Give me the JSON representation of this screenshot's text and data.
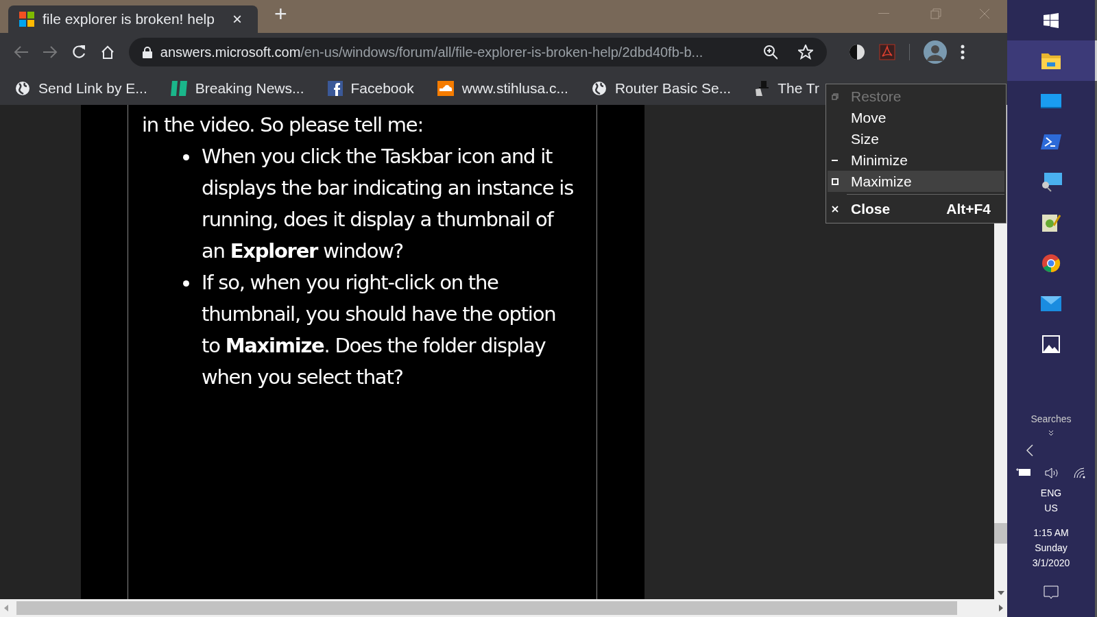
{
  "browser": {
    "tab": {
      "title": "file explorer is broken! help",
      "close": "×"
    },
    "new_tab": "+",
    "address": {
      "host": "answers.microsoft.com",
      "path": "/en-us/windows/forum/all/file-explorer-is-broken-help/2dbd40fb-b..."
    },
    "bookmarks": [
      {
        "kind": "globe",
        "label": "Send Link by E..."
      },
      {
        "kind": "news",
        "label": "Breaking News..."
      },
      {
        "kind": "facebook",
        "label": "Facebook"
      },
      {
        "kind": "cloud",
        "label": "www.stihlusa.c..."
      },
      {
        "kind": "globe",
        "label": "Router Basic Se..."
      },
      {
        "kind": "hat",
        "label": "The Tr"
      }
    ]
  },
  "content": {
    "intro": "in the video. So please tell me:",
    "bullets": [
      "When you click the Taskbar icon and it displays the bar indicating an instance is running, does it display a thumbnail of an **Explorer** window?",
      "If so, when you right-click on the thumbnail, you should have the option to **Maximize**. Does the folder display when you select that?"
    ]
  },
  "window_menu": [
    {
      "kind": "restore",
      "label": "Restore",
      "disabled": true,
      "selected": false
    },
    {
      "kind": "none",
      "label": "Move",
      "disabled": false,
      "selected": false
    },
    {
      "kind": "none",
      "label": "Size",
      "disabled": false,
      "selected": false
    },
    {
      "kind": "minimize",
      "label": "Minimize",
      "disabled": false,
      "selected": false
    },
    {
      "kind": "maximize",
      "label": "Maximize",
      "disabled": false,
      "selected": true
    },
    {
      "kind": "close",
      "label": "Close",
      "shortcut": "Alt+F4",
      "disabled": false,
      "selected": false
    }
  ],
  "taskbar": {
    "apps": [
      {
        "kind": "start",
        "selected": false
      },
      {
        "kind": "explorer",
        "selected": true
      },
      {
        "kind": "desktop",
        "selected": false
      },
      {
        "kind": "shell",
        "selected": false
      },
      {
        "kind": "remote",
        "selected": false
      },
      {
        "kind": "notepad",
        "selected": false
      },
      {
        "kind": "chrome",
        "selected": false
      },
      {
        "kind": "mail",
        "selected": false
      },
      {
        "kind": "photos",
        "selected": false
      }
    ],
    "searches": "Searches",
    "language": "ENG",
    "region": "US",
    "time": "1:15 AM",
    "day": "Sunday",
    "date": "3/1/2020"
  }
}
